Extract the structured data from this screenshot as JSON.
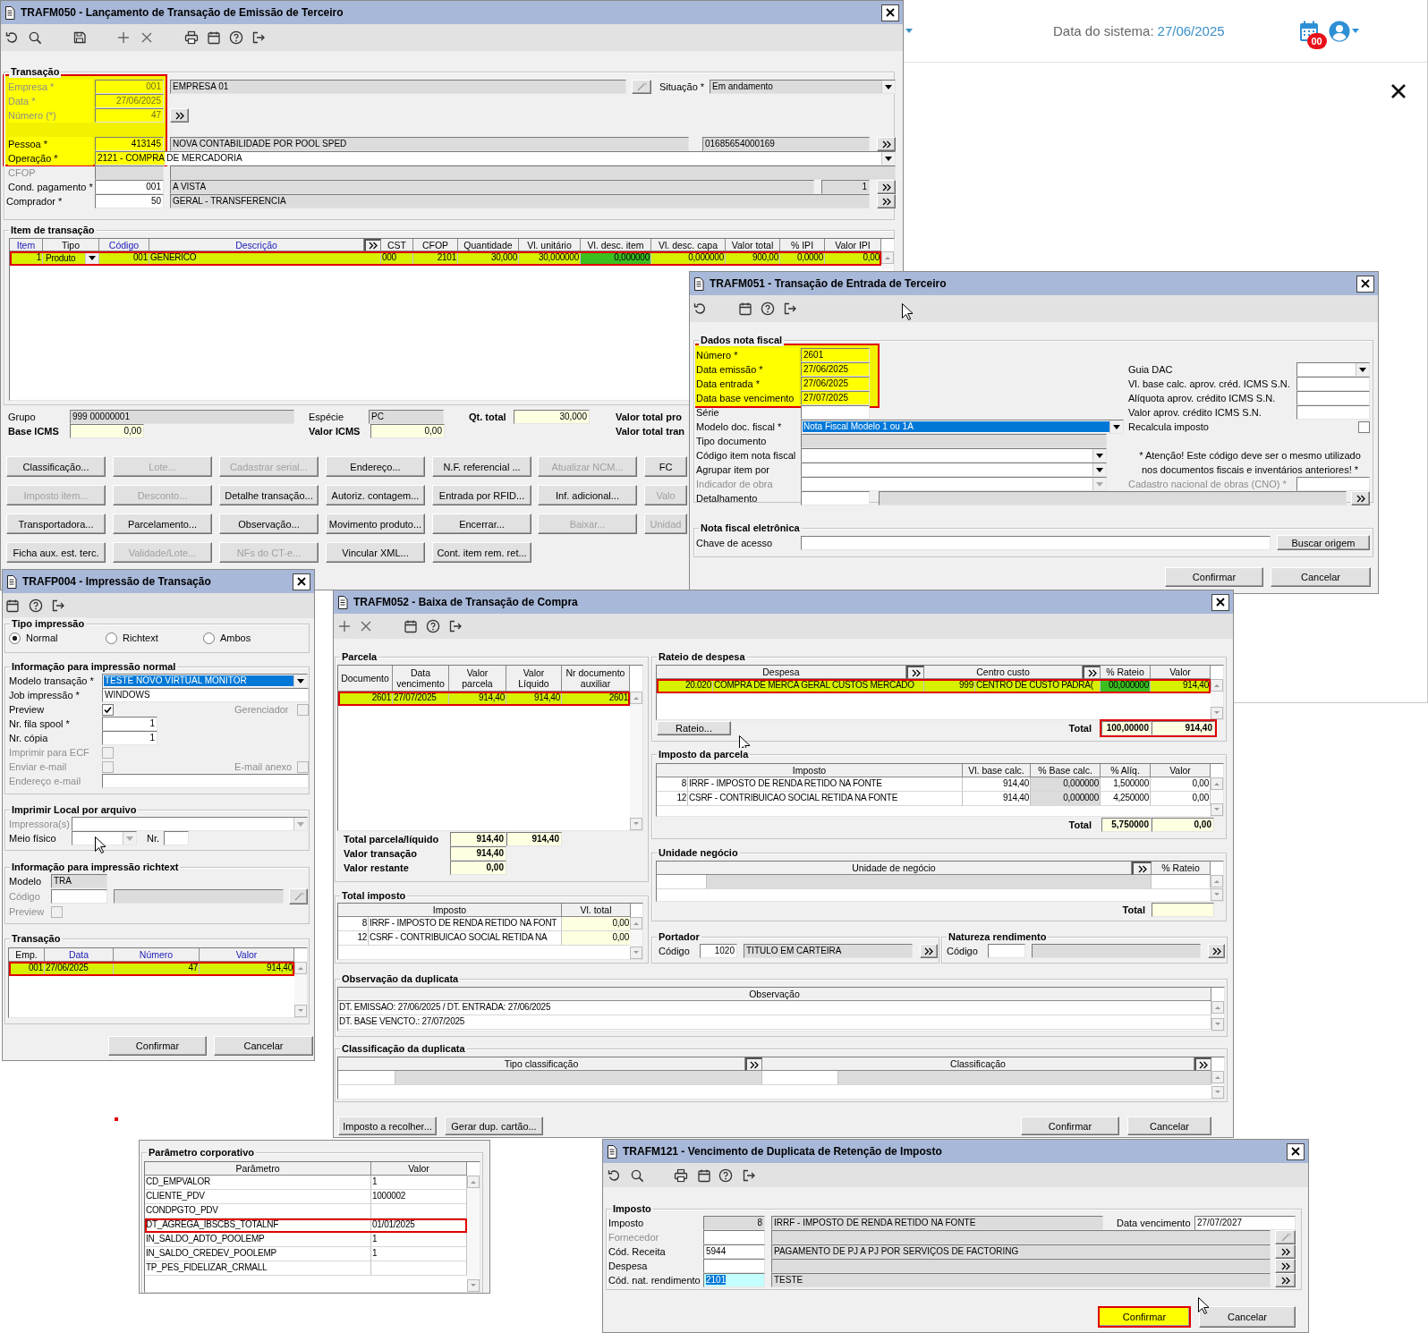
{
  "trafm050": {
    "title": "TRAFM050 - Lançamento de Transação de Emissão de Terceiro",
    "transacao": {
      "title": "Transação",
      "highlighted": true,
      "fields": [
        {
          "label": "Empresa *",
          "value": "001",
          "description": "EMPRESA 01",
          "disabled": true,
          "highlighted": true
        },
        {
          "label": "Data *",
          "value": "27/06/2025",
          "disabled": true,
          "highlighted": true
        },
        {
          "label": "Número (*)",
          "value": "47",
          "disabled": true,
          "highlighted": true
        },
        {
          "label": "Pessoa *",
          "value": "413145",
          "description": "NOVA CONTABILIDADE POR POOL SPED",
          "document": "01685654000169",
          "disabled": false,
          "highlighted": true
        },
        {
          "label": "Operação *",
          "value": "2121 - COMPRA DE MERCADORIA",
          "disabled": false,
          "highlighted": true
        },
        {
          "label": "CFOP",
          "disabled": true,
          "highlighted": false
        },
        {
          "label": "Cond. pagamento *",
          "value": "001",
          "description": "A VISTA",
          "count": "1",
          "disabled": false,
          "highlighted": false
        },
        {
          "label": "Comprador *",
          "value": "50",
          "description": "GERAL - TRANSFERENCIA",
          "disabled": false,
          "highlighted": false
        }
      ],
      "situacao": {
        "label": "Situação *",
        "value": "Em andamento"
      }
    },
    "items": {
      "title": "Item de transação",
      "columns": [
        {
          "label": "Item",
          "sortable": true
        },
        {
          "label": "Tipo",
          "sortable": false
        },
        {
          "label": "Código",
          "sortable": true
        },
        {
          "label": "Descrição",
          "sortable": true
        },
        {
          "label": "CST",
          "sortable": false
        },
        {
          "label": "CFOP",
          "sortable": false
        },
        {
          "label": "Quantidade",
          "sortable": false
        },
        {
          "label": "Vl. unitário",
          "sortable": false
        },
        {
          "label": "Vl. desc. item",
          "sortable": false
        },
        {
          "label": "Vl. desc. capa",
          "sortable": false
        },
        {
          "label": "Valor total",
          "sortable": false
        },
        {
          "label": "% IPI",
          "sortable": false
        },
        {
          "label": "Valor IPI",
          "sortable": false
        }
      ],
      "rows": [
        {
          "selected": true,
          "highlighted": true,
          "cells": [
            {
              "text": "1",
              "focused": false
            },
            {
              "text": "Produto",
              "focused": false
            },
            {
              "text": "001",
              "focused": false
            },
            {
              "text": "GENERICO",
              "focused": false
            },
            {
              "text": "000",
              "focused": false
            },
            {
              "text": "2101",
              "focused": false
            },
            {
              "text": "30,000",
              "focused": false
            },
            {
              "text": "30,000000",
              "focused": false
            },
            {
              "text": "0,000000",
              "focused": true
            },
            {
              "text": "0,000000",
              "focused": false
            },
            {
              "text": "900,00",
              "focused": false
            },
            {
              "text": "0,0000",
              "focused": false
            },
            {
              "text": "0,00",
              "focused": false
            }
          ]
        }
      ]
    },
    "summary": [
      {
        "label": "Grupo",
        "value": "999 00000001"
      },
      {
        "label": "Espécie",
        "value": "PC"
      },
      {
        "label": "Qt. total",
        "value": "30,000"
      },
      {
        "label": "Valor total pro"
      },
      {
        "label": "Base ICMS",
        "value": "0,00"
      },
      {
        "label": "Valor ICMS",
        "value": "0,00"
      },
      {
        "label": "Valor total tran"
      }
    ],
    "buttons": [
      [
        {
          "label": "Classificação...",
          "disabled": false
        },
        {
          "label": "Lote...",
          "disabled": true
        },
        {
          "label": "Cadastrar serial...",
          "disabled": true
        },
        {
          "label": "Endereço...",
          "disabled": false
        },
        {
          "label": "N.F. referencial ...",
          "disabled": false
        },
        {
          "label": "Atualizar NCM...",
          "disabled": true
        },
        {
          "label": "FC",
          "disabled": false
        }
      ],
      [
        {
          "label": "Imposto item...",
          "disabled": true
        },
        {
          "label": "Desconto...",
          "disabled": true
        },
        {
          "label": "Detalhe transação...",
          "disabled": false
        },
        {
          "label": "Autoriz. contagem...",
          "disabled": false
        },
        {
          "label": "Entrada por RFID...",
          "disabled": false
        },
        {
          "label": "Inf. adicional...",
          "disabled": false
        },
        {
          "label": "Valo",
          "disabled": true
        }
      ],
      [
        {
          "label": "Transportadora...",
          "disabled": false
        },
        {
          "label": "Parcelamento...",
          "disabled": false
        },
        {
          "label": "Observação...",
          "disabled": false
        },
        {
          "label": "Movimento produto...",
          "disabled": false
        },
        {
          "label": "Encerrar...",
          "disabled": false
        },
        {
          "label": "Baixar...",
          "disabled": true
        },
        {
          "label": "Unidad",
          "disabled": true
        }
      ],
      [
        {
          "label": "Ficha aux. est. terc.",
          "disabled": false
        },
        {
          "label": "Validade/Lote...",
          "disabled": true
        },
        {
          "label": "NFs do CT-e...",
          "disabled": true
        },
        {
          "label": "Vincular XML...",
          "disabled": false
        },
        {
          "label": "Cont. item rem. ret...",
          "disabled": false
        }
      ]
    ]
  },
  "desktop": {
    "date_label": "Data do sistema:",
    "date": "27/06/2025",
    "badge": "00"
  },
  "trafm051": {
    "title": "TRAFM051 - Transação de Entrada de Terceiro",
    "dados": {
      "title": "Dados nota fiscal",
      "highlighted": true,
      "fields": [
        {
          "kind": "input",
          "label": "Número *",
          "value": "2601",
          "highlighted": true,
          "disabled": false
        },
        {
          "kind": "input",
          "label": "Data emissão *",
          "value": "27/06/2025",
          "highlighted": true,
          "disabled": false
        },
        {
          "kind": "input",
          "label": "Data entrada *",
          "value": "27/06/2025",
          "highlighted": true,
          "disabled": false
        },
        {
          "kind": "input",
          "label": "Data base vencimento",
          "value": "27/07/2025",
          "highlighted": true,
          "disabled": false
        },
        {
          "kind": "input",
          "label": "Série",
          "highlighted": false,
          "disabled": false
        },
        {
          "kind": "dropdown",
          "label": "Modelo doc. fiscal *",
          "value": "Nota Fiscal Modelo 1 ou 1A",
          "focused": true,
          "highlighted": false,
          "disabled": false
        },
        {
          "kind": "readonly",
          "label": "Tipo documento",
          "highlighted": false,
          "disabled": false
        },
        {
          "kind": "dropdown",
          "label": "Código item nota fiscal",
          "focused": false,
          "highlighted": false,
          "disabled": false
        },
        {
          "kind": "dropdown",
          "label": "Agrupar item por",
          "focused": false,
          "highlighted": false,
          "disabled": false
        },
        {
          "kind": "dropdown",
          "label": "Indicador de obra",
          "focused": false,
          "highlighted": false,
          "disabled": true
        },
        {
          "kind": "lookup",
          "label": "Detalhamento",
          "highlighted": false,
          "disabled": false
        }
      ],
      "side": [
        {
          "kind": "dropdown",
          "label": "Guia DAC",
          "disabled": false
        },
        {
          "kind": "input",
          "label": "Vl. base calc. aprov. créd. ICMS S.N.",
          "disabled": false
        },
        {
          "kind": "input",
          "label": "Alíquota aprov. crédito ICMS S.N.",
          "disabled": false
        },
        {
          "kind": "input",
          "label": "Valor aprov. crédito ICMS S.N.",
          "disabled": false
        },
        {
          "kind": "checkbox",
          "label": "Recalcula imposto",
          "checked": false,
          "disabled": false
        },
        {
          "kind": "note",
          "lines": [
            "* Atenção! Este código deve ser o mesmo utilizado",
            "nos documentos fiscais e inventários anteriores! *"
          ]
        },
        {
          "kind": "input",
          "label": "Cadastro nacional de obras (CNO) *",
          "disabled": true
        }
      ]
    },
    "nfe": {
      "title": "Nota fiscal eletrônica",
      "label": "Chave de acesso",
      "button": "Buscar origem"
    },
    "buttons": [
      "Confirmar",
      "Cancelar"
    ]
  },
  "trafp004": {
    "title": "TRAFP004 - Impressão de Transação",
    "tipo": {
      "title": "Tipo impressão",
      "options": [
        {
          "label": "Normal",
          "selected": true
        },
        {
          "label": "Richtext",
          "selected": false
        },
        {
          "label": "Ambos",
          "selected": false
        }
      ]
    },
    "normal": {
      "title": "Informação para impressão normal",
      "fields": [
        {
          "kind": "dropdown",
          "label": "Modelo transação *",
          "value": "TESTE NOVO VIRTUAL MONITOR",
          "focused": true,
          "disabled": false
        },
        {
          "kind": "input",
          "label": "Job impressão *",
          "value": "WINDOWS",
          "disabled": false
        },
        {
          "kind": "checkbox",
          "label": "Preview",
          "checked": true,
          "disabled": false,
          "extra": {
            "label": "Gerenciador",
            "checked": false,
            "disabled": true
          }
        },
        {
          "kind": "number",
          "label": "Nr. fila spool *",
          "value": "1",
          "disabled": false
        },
        {
          "kind": "number",
          "label": "Nr. cópia",
          "value": "1",
          "disabled": false
        },
        {
          "kind": "checkbox",
          "label": "Imprimir para ECF",
          "checked": false,
          "disabled": true
        },
        {
          "kind": "checkbox",
          "label": "Enviar e-mail",
          "checked": false,
          "disabled": true,
          "extra": {
            "label": "E-mail anexo",
            "checked": false,
            "disabled": true
          }
        },
        {
          "kind": "input",
          "label": "Endereço e-mail",
          "disabled": true
        }
      ]
    },
    "local": {
      "title": "Imprimir Local por arquivo",
      "printer_label": "Impressora(s)",
      "printer_disabled": true,
      "medium_label": "Meio físico",
      "number_label": "Nr."
    },
    "richtext": {
      "title": "Informação para impressão richtext",
      "model_label": "Modelo",
      "model": "TRA",
      "code_label": "Código",
      "code_disabled": true,
      "preview_label": "Preview",
      "preview_disabled": true,
      "preview_checked": false
    },
    "transacao": {
      "title": "Transação",
      "columns": [
        {
          "label": "Emp.",
          "sortable": false
        },
        {
          "label": "Data",
          "sortable": true
        },
        {
          "label": "Número",
          "sortable": true
        },
        {
          "label": "Valor",
          "sortable": true
        }
      ],
      "rows": [
        {
          "selected": true,
          "highlighted": true,
          "cells": [
            "001",
            "27/06/2025",
            "47",
            "914,40"
          ]
        }
      ]
    },
    "buttons": [
      "Confirmar",
      "Cancelar"
    ]
  },
  "trafm052": {
    "title": "TRAFM052 - Baixa de Transação de Compra",
    "parcela": {
      "title": "Parcela",
      "columns": [
        "Documento",
        "Data\nvencimento",
        "Valor\nparcela",
        "Valor\nLíquido",
        "Nr documento\nauxiliar"
      ],
      "rows": [
        {
          "selected": true,
          "highlighted": true,
          "cells": [
            "2601",
            "27/07/2025",
            "914,40",
            "914,40",
            "2601"
          ]
        }
      ],
      "totals": [
        {
          "label": "Total parcela/líquido",
          "values": [
            "914,40",
            "914,40"
          ]
        },
        {
          "label": "Valor transação",
          "values": [
            "914,40"
          ]
        },
        {
          "label": "Valor restante",
          "values": [
            "0,00"
          ]
        }
      ]
    },
    "total_imposto": {
      "title": "Total imposto",
      "columns": [
        "",
        "Imposto",
        "Vl. total"
      ],
      "rows": [
        [
          "8",
          "IRRF - IMPOSTO DE RENDA RETIDO NA FONT",
          "0,00"
        ],
        [
          "12",
          "CSRF - CONTRIBUICAO SOCIAL RETIDA NA",
          "0,00"
        ]
      ]
    },
    "rateio": {
      "title": "Rateio de despesa",
      "columns": [
        "",
        "Despesa",
        "",
        "Centro custo",
        "% Rateio",
        "Valor"
      ],
      "rows": [
        {
          "selected": true,
          "highlighted": true,
          "cells": [
            {
              "text": "20.020",
              "focused": false
            },
            {
              "text": "COMPRA DE MERCA GERAL CUSTOS MERCADO",
              "focused": false
            },
            {
              "text": "999",
              "focused": false
            },
            {
              "text": "CENTRO DE CUSTO PADRA(",
              "focused": false
            },
            {
              "text": "00,000000",
              "focused": true
            },
            {
              "text": "914,40",
              "focused": false
            }
          ]
        }
      ],
      "button": "Rateio...",
      "total_label": "Total",
      "totals": [
        "100,00000",
        "914,40"
      ],
      "totals_highlighted": true
    },
    "imposto_parcela": {
      "title": "Imposto da parcela",
      "columns": [
        "",
        "Imposto",
        "Vl. base calc.",
        "% Base calc.",
        "% Alíq.",
        "Valor"
      ],
      "rows": [
        [
          "8",
          "IRRF - IMPOSTO DE RENDA RETIDO NA FONTE",
          "914,40",
          "0,000000",
          "1,500000",
          "0,00"
        ],
        [
          "12",
          "CSRF - CONTRIBUICAO SOCIAL RETIDA NA FONTE",
          "914,40",
          "0,000000",
          "4,250000",
          "0,00"
        ]
      ],
      "total_label": "Total",
      "totals": [
        "5,750000",
        "0,00"
      ]
    },
    "unidade": {
      "title": "Unidade negócio",
      "columns": [
        "Unidade de negócio",
        "% Rateio"
      ],
      "total_label": "Total"
    },
    "portador": {
      "title": "Portador",
      "label": "Código",
      "code": "1020",
      "description": "TITULO EM CARTEIRA"
    },
    "natureza": {
      "title": "Natureza rendimento",
      "label": "Código"
    },
    "observacao": {
      "title": "Observação da duplicata",
      "column": "Observação",
      "rows": [
        "DT. EMISSAO: 27/06/2025 / DT. ENTRADA: 27/06/2025",
        "DT. BASE VENCTO.: 27/07/2025"
      ]
    },
    "classificacao": {
      "title": "Classificação da duplicata",
      "columns": [
        "Tipo classificação",
        "Classificação"
      ]
    },
    "buttons": [
      "Imposto a recolher...",
      "Gerar dup. cartão...",
      "Confirmar",
      "Cancelar"
    ]
  },
  "parametros": {
    "title": "Parâmetro corporativo",
    "columns": [
      "Parâmetro",
      "Valor"
    ],
    "rows": [
      {
        "name": "CD_EMPVALOR",
        "value": "1",
        "highlighted": false
      },
      {
        "name": "CLIENTE_PDV",
        "value": "1000002",
        "highlighted": false
      },
      {
        "name": "CONDPGTO_PDV",
        "highlighted": false
      },
      {
        "name": "DT_AGREGA_IBSCBS_TOTALNF",
        "value": "01/01/2025",
        "highlighted": true
      },
      {
        "name": "IN_SALDO_ADTO_POOLEMP",
        "value": "1",
        "highlighted": false
      },
      {
        "name": "IN_SALDO_CREDEV_POOLEMP",
        "value": "1",
        "highlighted": false
      },
      {
        "name": "TP_PES_FIDELIZAR_CRMALL",
        "highlighted": false
      }
    ]
  },
  "trafm121": {
    "title": "TRAFM121 - Vencimento de Duplicata de Retenção de Imposto",
    "group": "Imposto",
    "fields": [
      {
        "kind": "readonly",
        "label": "Imposto",
        "code": "8",
        "description": "IRRF - IMPOSTO DE RENDA RETIDO NA FONTE",
        "disabled": false
      },
      {
        "kind": "wand",
        "label": "Fornecedor",
        "disabled": true
      },
      {
        "kind": "lookup",
        "label": "Cód. Receita",
        "code": "5944",
        "description": "PAGAMENTO DE PJ A PJ POR SERVIÇOS DE FACTORING",
        "disabled": false,
        "focused": false
      },
      {
        "kind": "lookup",
        "label": "Despesa",
        "disabled": false,
        "focused": false
      },
      {
        "kind": "lookup",
        "label": "Cód. nat. rendimento",
        "code": "2101",
        "description": "TESTE",
        "disabled": false,
        "focused": true
      }
    ],
    "due": {
      "label": "Data vencimento",
      "value": "27/07/2027"
    },
    "buttons": [
      {
        "label": "Confirmar",
        "highlighted": true
      },
      {
        "label": "Cancelar",
        "highlighted": false
      }
    ]
  }
}
